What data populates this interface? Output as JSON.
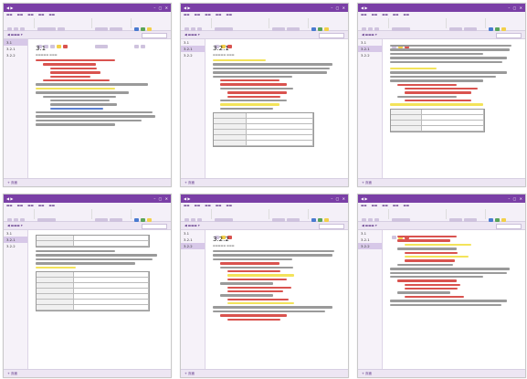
{
  "app": {
    "window_title": "",
    "ribbon_tabs": [
      "",
      "",
      "",
      "",
      "",
      ""
    ],
    "status_label": "页面"
  },
  "screens": [
    {
      "sections": [
        "3.1",
        "3.2.1",
        "3.2.2"
      ],
      "selected": 0,
      "page_title": "3.1"
    },
    {
      "sections": [
        "3.1",
        "3.2.1",
        "3.2.2"
      ],
      "selected": 1,
      "page_title": "3.2.1"
    },
    {
      "sections": [
        "3.1",
        "3.2.1",
        "3.2.2"
      ],
      "selected": 1,
      "page_title": ""
    },
    {
      "sections": [
        "3.1",
        "3.2.1",
        "3.2.2"
      ],
      "selected": 1,
      "page_title": ""
    },
    {
      "sections": [
        "3.1",
        "3.2.1",
        "3.2.2"
      ],
      "selected": 2,
      "page_title": "3.2.2"
    },
    {
      "sections": [
        "3.1",
        "3.2.1",
        "3.2.2"
      ],
      "selected": 2,
      "page_title": ""
    }
  ]
}
